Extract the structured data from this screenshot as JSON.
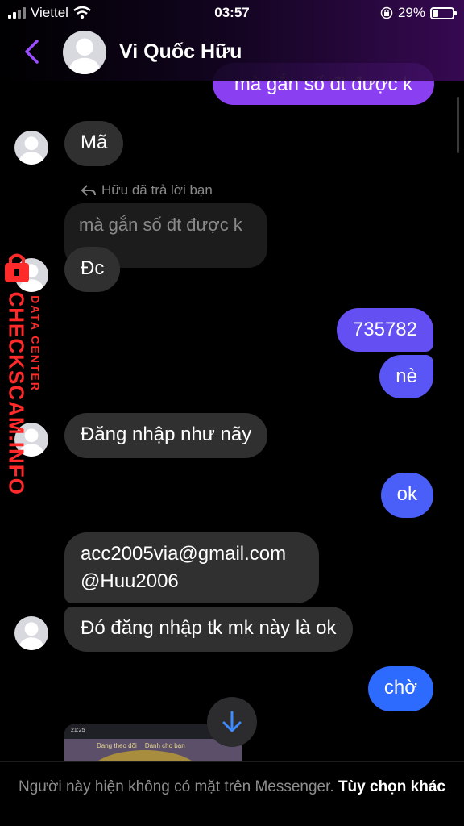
{
  "status_bar": {
    "carrier": "Viettel",
    "time": "03:57",
    "battery_percent": "29%",
    "battery_level": 0.29
  },
  "header": {
    "contact_name": "Vi Quốc Hữu",
    "accent": "#9b4dff"
  },
  "messages": {
    "m1": "mà gắn số đt được k",
    "m2": "Mã",
    "reply_note": "Hữu đã trả lời bạn",
    "quoted": "mà gắn số đt được k",
    "m3": "Đc",
    "m4": "735782",
    "m5": "nè",
    "m6": "Đăng nhập như nãy",
    "m7": "ok",
    "m8_line1": "acc2005via@gmail.com",
    "m8_line2": "@Huu2006",
    "m9": "Đó đăng nhập tk mk này là ok",
    "m10": "chờ"
  },
  "watermark": {
    "main": "CHECKSCAM.INFO",
    "sub": "DATA CENTER"
  },
  "preview": {
    "time": "21:25",
    "tab1": "Đang theo dõi",
    "tab2": "Dành cho bạn"
  },
  "bottom": {
    "note": "Người này hiện không có mặt trên Messenger.",
    "options": "Tùy chọn khác"
  },
  "colors": {
    "outgoing_top": "#7b3fe4",
    "outgoing_mid": "#6a4cf0",
    "outgoing_bottom": "#2d6bff",
    "incoming": "#303030",
    "watermark": "#ff2a2a"
  }
}
